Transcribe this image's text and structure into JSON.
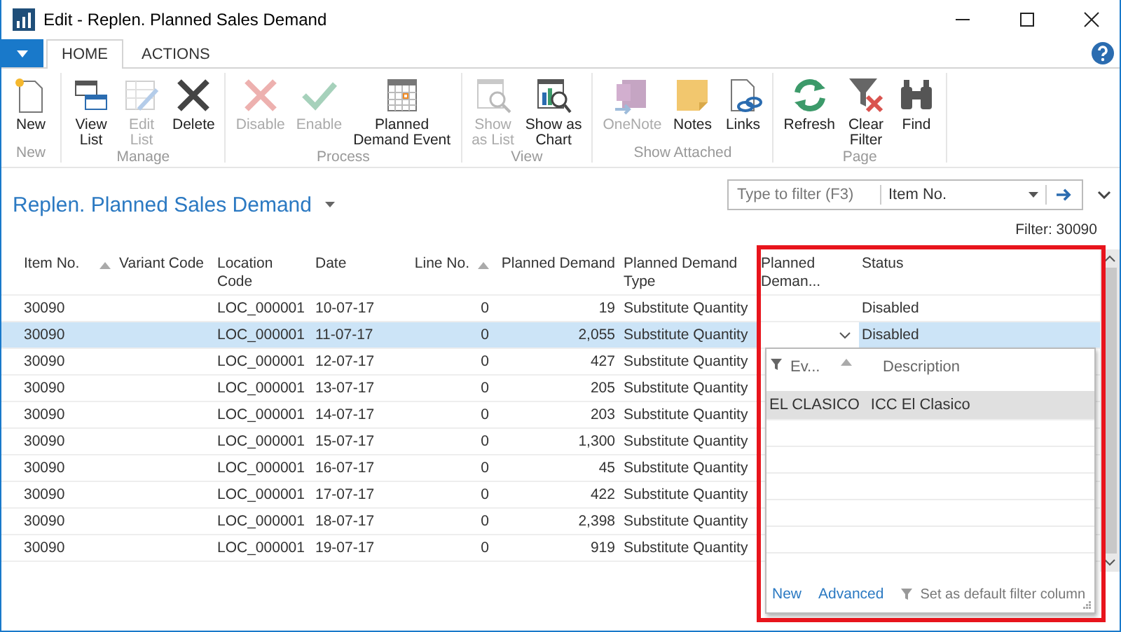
{
  "window": {
    "title": "Edit - Replen. Planned Sales Demand"
  },
  "tabs": [
    {
      "label": "HOME",
      "selected": true
    },
    {
      "label": "ACTIONS",
      "selected": false
    }
  ],
  "ribbon": [
    {
      "label": "New",
      "buttons": [
        {
          "kind": "new",
          "lines": [
            "New"
          ],
          "disabled": false
        }
      ]
    },
    {
      "label": "Manage",
      "buttons": [
        {
          "kind": "view-list",
          "lines": [
            "View",
            "List"
          ],
          "disabled": false
        },
        {
          "kind": "edit-list",
          "lines": [
            "Edit",
            "List"
          ],
          "disabled": true
        },
        {
          "kind": "delete",
          "lines": [
            "Delete"
          ],
          "disabled": false
        }
      ]
    },
    {
      "label": "Process",
      "buttons": [
        {
          "kind": "disable",
          "lines": [
            "Disable"
          ],
          "disabled": true
        },
        {
          "kind": "enable",
          "lines": [
            "Enable"
          ],
          "disabled": true
        },
        {
          "kind": "event",
          "lines": [
            "Planned",
            "Demand Event"
          ],
          "disabled": false
        }
      ]
    },
    {
      "label": "View",
      "buttons": [
        {
          "kind": "show-list",
          "lines": [
            "Show",
            "as List"
          ],
          "disabled": true
        },
        {
          "kind": "show-chart",
          "lines": [
            "Show as",
            "Chart"
          ],
          "disabled": false
        }
      ]
    },
    {
      "label": "Show Attached",
      "buttons": [
        {
          "kind": "onenote",
          "lines": [
            "OneNote"
          ],
          "disabled": true
        },
        {
          "kind": "notes",
          "lines": [
            "Notes"
          ],
          "disabled": false
        },
        {
          "kind": "links",
          "lines": [
            "Links"
          ],
          "disabled": false
        }
      ]
    },
    {
      "label": "Page",
      "buttons": [
        {
          "kind": "refresh",
          "lines": [
            "Refresh"
          ],
          "disabled": false
        },
        {
          "kind": "clear-filter",
          "lines": [
            "Clear",
            "Filter"
          ],
          "disabled": false
        },
        {
          "kind": "find",
          "lines": [
            "Find"
          ],
          "disabled": false
        }
      ]
    }
  ],
  "page": {
    "title": "Replen. Planned Sales Demand",
    "filter_placeholder": "Type to filter (F3)",
    "filter_field": "Item No.",
    "filter_text": "Filter: 30090"
  },
  "table": {
    "columns": [
      {
        "label": "Item No.",
        "sorted": true
      },
      {
        "label": "Variant Code",
        "sorted": false
      },
      {
        "label": "Location Code",
        "sorted": false
      },
      {
        "label": "Date",
        "sorted": false
      },
      {
        "label": "Line No.",
        "sorted": true
      },
      {
        "label": "Planned Demand",
        "sorted": false
      },
      {
        "label": "Planned Demand Type",
        "sorted": false
      },
      {
        "label": "Planned Deman...",
        "sorted": false
      },
      {
        "label": "Status",
        "sorted": false
      }
    ],
    "rows": [
      {
        "selected": false,
        "editing": false,
        "cells": [
          "30090",
          "",
          "LOC_000001",
          "10-07-17",
          "0",
          "19",
          "Substitute Quantity",
          "",
          "Disabled"
        ]
      },
      {
        "selected": true,
        "editing": true,
        "cells": [
          "30090",
          "",
          "LOC_000001",
          "11-07-17",
          "0",
          "2,055",
          "Substitute Quantity",
          "",
          "Disabled"
        ]
      },
      {
        "selected": false,
        "editing": false,
        "cells": [
          "30090",
          "",
          "LOC_000001",
          "12-07-17",
          "0",
          "427",
          "Substitute Quantity"
        ]
      },
      {
        "selected": false,
        "editing": false,
        "cells": [
          "30090",
          "",
          "LOC_000001",
          "13-07-17",
          "0",
          "205",
          "Substitute Quantity"
        ]
      },
      {
        "selected": false,
        "editing": false,
        "cells": [
          "30090",
          "",
          "LOC_000001",
          "14-07-17",
          "0",
          "203",
          "Substitute Quantity"
        ]
      },
      {
        "selected": false,
        "editing": false,
        "cells": [
          "30090",
          "",
          "LOC_000001",
          "15-07-17",
          "0",
          "1,300",
          "Substitute Quantity"
        ]
      },
      {
        "selected": false,
        "editing": false,
        "cells": [
          "30090",
          "",
          "LOC_000001",
          "16-07-17",
          "0",
          "45",
          "Substitute Quantity"
        ]
      },
      {
        "selected": false,
        "editing": false,
        "cells": [
          "30090",
          "",
          "LOC_000001",
          "17-07-17",
          "0",
          "422",
          "Substitute Quantity"
        ]
      },
      {
        "selected": false,
        "editing": false,
        "cells": [
          "30090",
          "",
          "LOC_000001",
          "18-07-17",
          "0",
          "2,398",
          "Substitute Quantity"
        ]
      },
      {
        "selected": false,
        "editing": false,
        "cells": [
          "30090",
          "",
          "LOC_000001",
          "19-07-17",
          "0",
          "919",
          "Substitute Quantity"
        ]
      }
    ]
  },
  "lookup": {
    "columns": [
      "Ev...",
      "Description"
    ],
    "rows": [
      {
        "cells": [
          "EL CLASICO",
          "ICC El Clasico"
        ],
        "selected": true
      }
    ],
    "links": [
      "New",
      "Advanced"
    ],
    "default_filter": "Set as default filter column"
  },
  "highlight_frame": true
}
